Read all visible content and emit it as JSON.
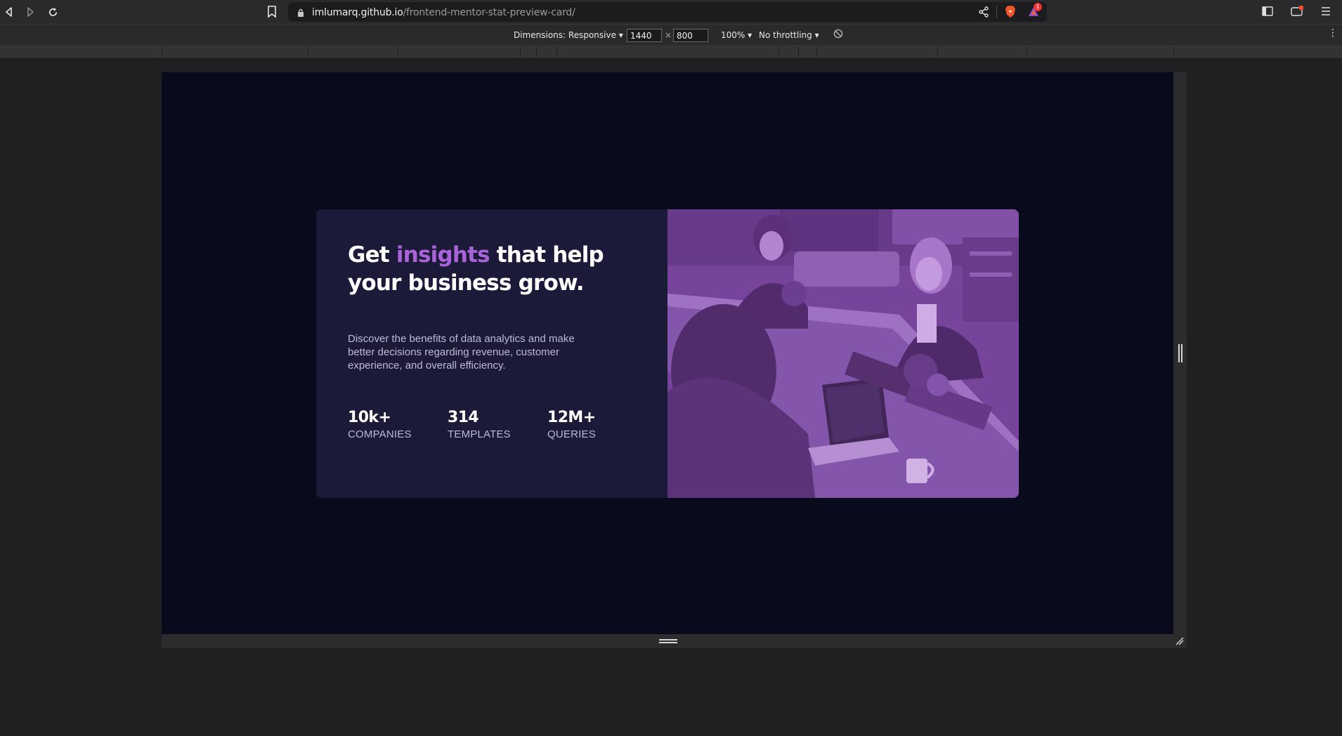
{
  "browser": {
    "url_host": "imlumarq.github.io",
    "url_path": "/frontend-mentor-stat-preview-card/",
    "icons": [
      "back-icon",
      "forward-icon",
      "reload-icon",
      "bookmark-icon",
      "lock-icon",
      "share-icon",
      "brave-shield-icon",
      "brave-rewards-icon",
      "sidebar-icon",
      "wallet-icon",
      "menu-icon"
    ],
    "rewards_badge": "1"
  },
  "devtools": {
    "dimensions_label": "Dimensions: Responsive",
    "width_value": "1440",
    "height_value": "800",
    "times": "×",
    "zoom": "100%",
    "throttling": "No throttling"
  },
  "card": {
    "heading_before": "Get ",
    "heading_accent": "insights",
    "heading_after": " that help your business grow.",
    "description": "Discover the benefits of data analytics and make better decisions regarding revenue, customer experience, and overall efficiency.",
    "stats": [
      {
        "value": "10k+",
        "label": "COMPANIES"
      },
      {
        "value": "314",
        "label": "TEMPLATES"
      },
      {
        "value": "12M+",
        "label": "QUERIES"
      }
    ],
    "colors": {
      "background": "#090b1c",
      "card": "#1c1a39",
      "accent": "#a963d8",
      "image_tint": "#6a3f8c"
    }
  }
}
